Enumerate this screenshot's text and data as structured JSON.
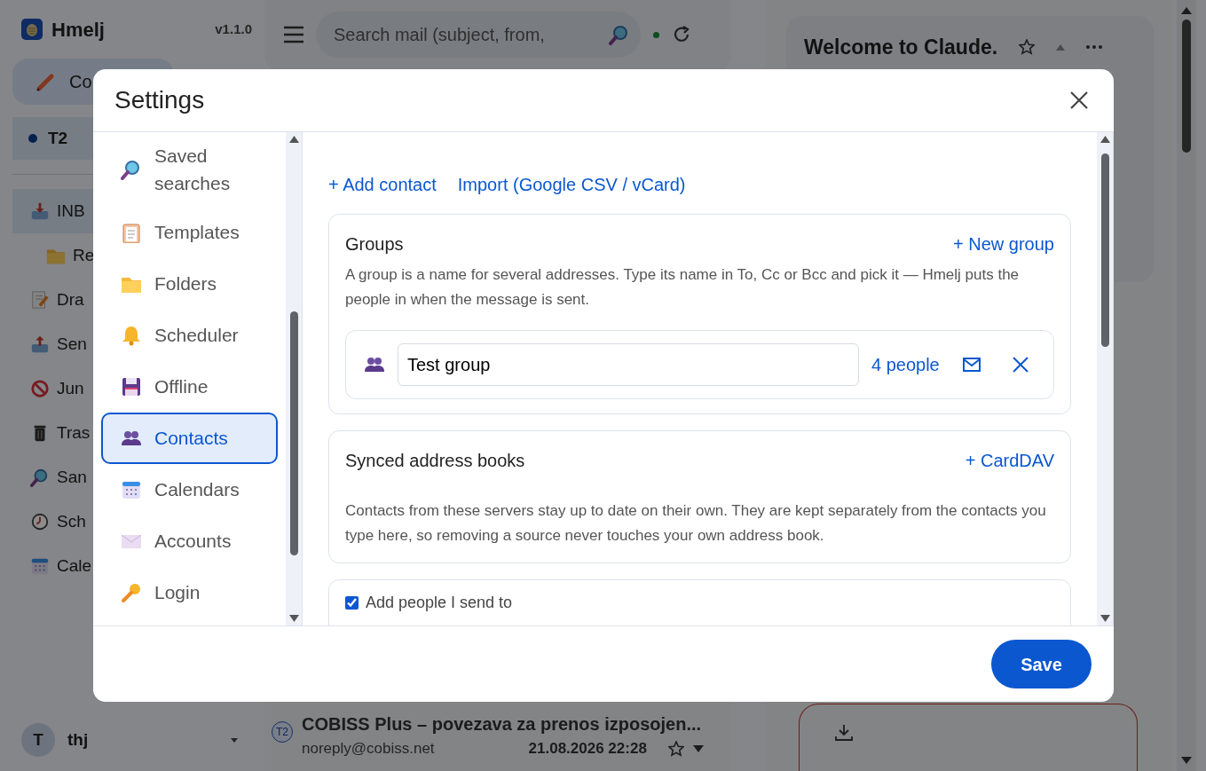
{
  "app": {
    "brand": "Hmelj",
    "version": "v1.1.0",
    "compose": "Co",
    "account": {
      "label": "T2",
      "selected": true
    },
    "folders": [
      {
        "label": "INB",
        "selected": true,
        "children": [
          {
            "label": "Re",
            "selected": false
          }
        ]
      },
      {
        "label": "Dra",
        "selected": false
      },
      {
        "label": "Sen",
        "selected": false
      },
      {
        "label": "Jun",
        "selected": false
      },
      {
        "label": "Tras",
        "selected": false
      },
      {
        "label": "San",
        "selected": false
      },
      {
        "label": "Sch",
        "selected": false
      },
      {
        "label": "Cale",
        "selected": false
      }
    ],
    "user": {
      "initial": "T",
      "name": "thj"
    },
    "search": {
      "placeholder": "Search mail (subject, from,"
    },
    "message": {
      "badge": "T2",
      "subject": "COBISS Plus – povezava za prenos izposojen...",
      "from": "noreply@cobiss.net",
      "date": "21.08.2026 22:28"
    },
    "reading": {
      "title": "Welcome to Claude."
    }
  },
  "settings": {
    "title": "Settings",
    "nav": [
      {
        "label": "Saved searches",
        "selected": false
      },
      {
        "label": "Templates",
        "selected": false
      },
      {
        "label": "Folders",
        "selected": false
      },
      {
        "label": "Scheduler",
        "selected": false
      },
      {
        "label": "Offline",
        "selected": false
      },
      {
        "label": "Contacts",
        "selected": true
      },
      {
        "label": "Calendars",
        "selected": false
      },
      {
        "label": "Accounts",
        "selected": false
      },
      {
        "label": "Login",
        "selected": false
      }
    ],
    "actions": [
      "+ Add contact",
      "Import (Google CSV / vCard)"
    ],
    "groups": {
      "title": "Groups",
      "add": "+ New group",
      "description": "A group is a name for several addresses. Type its name in To, Cc or Bcc and pick it — Hmelj puts the people in when the message is sent.",
      "items": [
        {
          "name": "Test group",
          "count": "4 people"
        }
      ]
    },
    "synced": {
      "title": "Synced address books",
      "add": "+ CardDAV",
      "description": "Contacts from these servers stay up to date on their own. They are kept separately from the contacts you type here, so removing a source never touches your own address book."
    },
    "options": [
      {
        "label": "Add people I send to",
        "checked": true
      }
    ],
    "save": "Save"
  }
}
